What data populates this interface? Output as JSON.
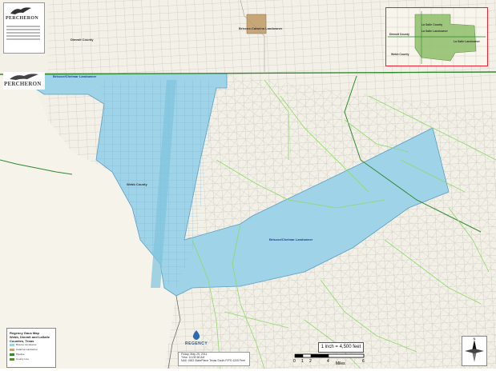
{
  "company": {
    "name": "PERCHERON",
    "inset_company": "PERCHERON"
  },
  "labels": {
    "top_landowner": "Briscoe-Catarina Landowner",
    "county_upper_left": "Dimmit County",
    "county_left": "Webb County",
    "blue_left": "Briscoe/Chelmar Landowner",
    "blue_main": "Briscoe/Chelmar Landowner"
  },
  "inset": {
    "labels": [
      "Dimmit County",
      "La Salle County",
      "Webb County",
      "La Salle Landowner",
      "La Salle Landowner"
    ]
  },
  "legend": {
    "title": "Regency Gaus Map\nWebb, Dimmit and LaSalle Counties, Texas",
    "items": [
      "Briscoe Landowner",
      "Catarina Landowner",
      "Pipeline",
      "County Line"
    ],
    "colors": [
      "#9fd3e8",
      "#c7a777",
      "#2d8a2d",
      "#5a8a2a"
    ]
  },
  "notes": [
    "Friday, May 25, 2011",
    "Time: 10:09:38 AM",
    "NAD 1983 StatePlane Texas South FIPS 4205 Feet"
  ],
  "brand": {
    "regency": "REGENCY"
  },
  "scale": {
    "ratio": "1 inch = 4,500 feet",
    "ticks": [
      "0",
      "1",
      "2",
      "4",
      "6"
    ],
    "unit": "Miles"
  },
  "colors": {
    "blue": "#9fd3e8",
    "green": "#2d8a2d",
    "lightgreen": "#8fd86a",
    "tan": "#c7a777",
    "land": "#f3f1e7"
  }
}
